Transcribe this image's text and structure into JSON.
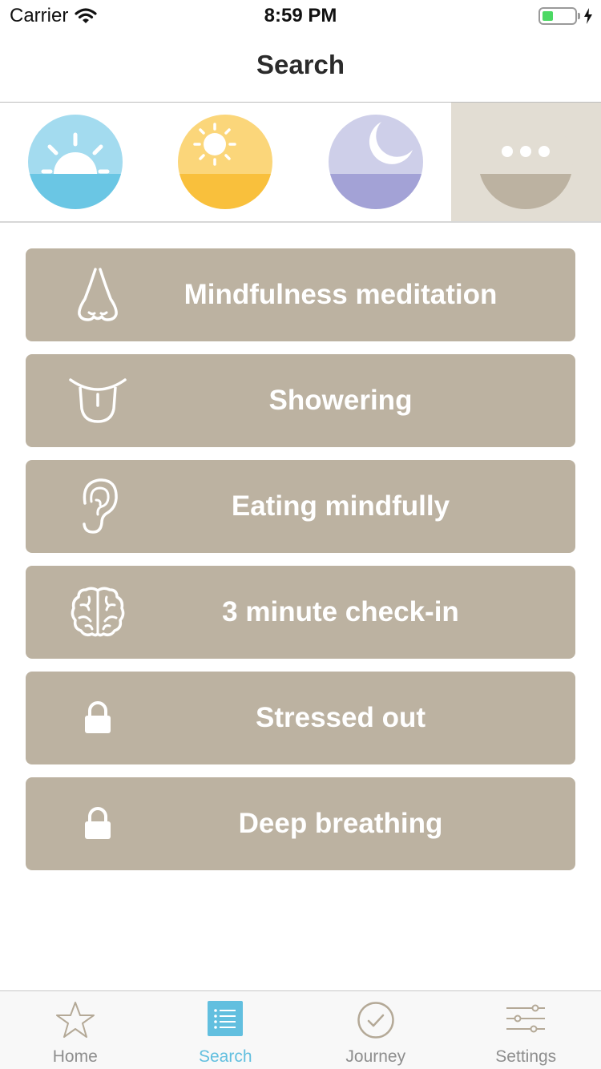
{
  "status_bar": {
    "carrier": "Carrier",
    "time": "8:59 PM",
    "battery_level": 0.35
  },
  "nav": {
    "title": "Search"
  },
  "categories": [
    {
      "name": "sunrise",
      "top_color": "#a3dbef",
      "bottom_color": "#6ac6e4"
    },
    {
      "name": "midday",
      "top_color": "#fbd67a",
      "bottom_color": "#f9c03c"
    },
    {
      "name": "night",
      "top_color": "#cecfe9",
      "bottom_color": "#a3a2d6"
    },
    {
      "name": "more",
      "top_color": "#e2ddd3",
      "bottom_color": "#bcb2a1",
      "selected": true
    }
  ],
  "items": [
    {
      "label": "Mindfulness meditation",
      "icon": "nose-icon"
    },
    {
      "label": "Showering",
      "icon": "tongue-icon"
    },
    {
      "label": "Eating mindfully",
      "icon": "ear-icon"
    },
    {
      "label": "3 minute check-in",
      "icon": "brain-icon"
    },
    {
      "label": "Stressed out",
      "icon": "lock-icon"
    },
    {
      "label": "Deep breathing",
      "icon": "lock-icon"
    }
  ],
  "tabs": [
    {
      "label": "Home",
      "icon": "star-icon"
    },
    {
      "label": "Search",
      "icon": "list-icon",
      "active": true
    },
    {
      "label": "Journey",
      "icon": "checkmark-circle-icon"
    },
    {
      "label": "Settings",
      "icon": "sliders-icon"
    }
  ],
  "colors": {
    "item_bg": "#bcb2a1",
    "accent": "#62bfdf",
    "selected_category_bg": "#e2ddd3",
    "tab_inactive": "#8e8e8e"
  }
}
